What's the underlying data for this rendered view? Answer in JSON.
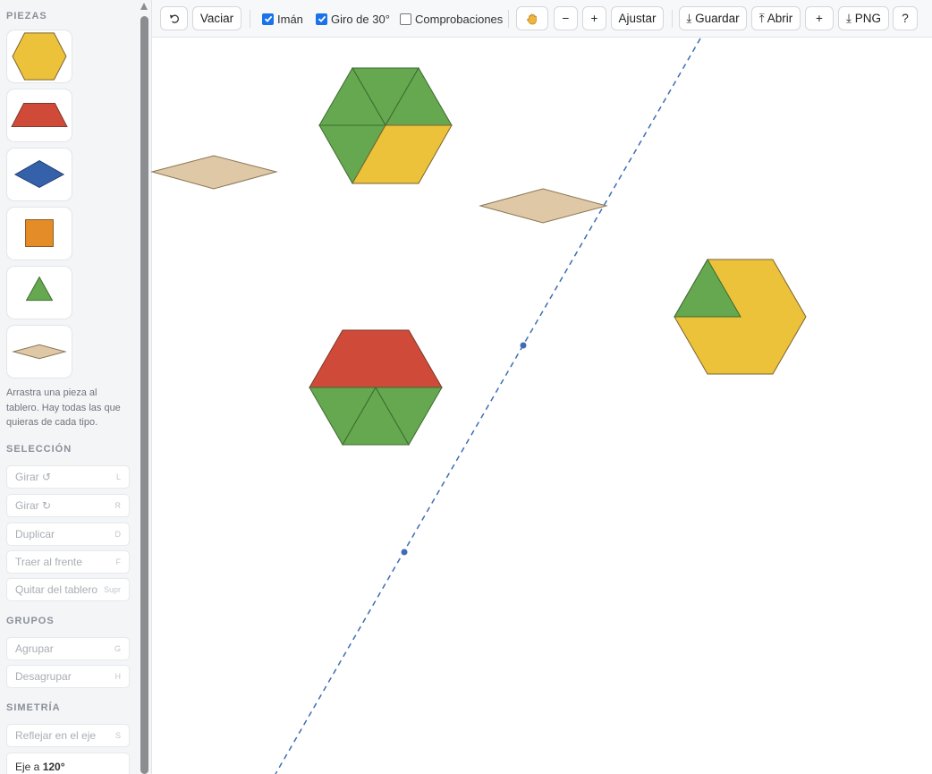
{
  "sidebar": {
    "pieces_title": "PIEZAS",
    "pieces": [
      {
        "name": "hexagon",
        "color": "#ecc23b"
      },
      {
        "name": "trapezoid",
        "color": "#d04a3a"
      },
      {
        "name": "blue-rhombus",
        "color": "#3560aa"
      },
      {
        "name": "square",
        "color": "#e48c27"
      },
      {
        "name": "triangle",
        "color": "#65a850"
      },
      {
        "name": "tan-rhombus",
        "color": "#dfc8a6"
      }
    ],
    "hint": "Arrastra una pieza al tablero. Hay todas las que quieras de cada tipo.",
    "selection_title": "SELECCIÓN",
    "selection_actions": [
      {
        "label": "Girar ↺",
        "key": "L"
      },
      {
        "label": "Girar ↻",
        "key": "R"
      },
      {
        "label": "Duplicar",
        "key": "D"
      },
      {
        "label": "Traer al frente",
        "key": "F"
      },
      {
        "label": "Quitar del tablero",
        "key": "Supr"
      }
    ],
    "groups_title": "GRUPOS",
    "group_actions": [
      {
        "label": "Agrupar",
        "key": "G"
      },
      {
        "label": "Desagrupar",
        "key": "H"
      }
    ],
    "symmetry_title": "SIMETRÍA",
    "symmetry_actions": [
      {
        "label": "Reflejar en el eje",
        "key": "S"
      }
    ],
    "axis_prefix": "Eje a",
    "axis_angle": "120°"
  },
  "toolbar": {
    "undo_icon": "undo-icon",
    "clear_label": "Vaciar",
    "magnet_label": "Imán",
    "magnet_checked": true,
    "snap30_label": "Giro de 30°",
    "snap30_checked": true,
    "checks_label": "Comprobaciones",
    "checks_checked": false,
    "pan_icon": "hand-icon",
    "zoom_out_label": "−",
    "zoom_in_label": "+",
    "fit_label": "Ajustar",
    "save_label": "⤓ Guardar",
    "open_label": "⤒ Abrir",
    "add_label": "+",
    "png_label": "⤓ PNG",
    "help_label": "?"
  },
  "colors": {
    "hexagon_fill": "#ecc23b",
    "trapezoid_fill": "#d04a3a",
    "blue_rhombus_fill": "#3560aa",
    "square_fill": "#e48c27",
    "triangle_fill": "#65a850",
    "tan_rhombus_fill": "#dfc8a6",
    "stroke": "#6b5a34",
    "axis": "#3f6db3"
  }
}
